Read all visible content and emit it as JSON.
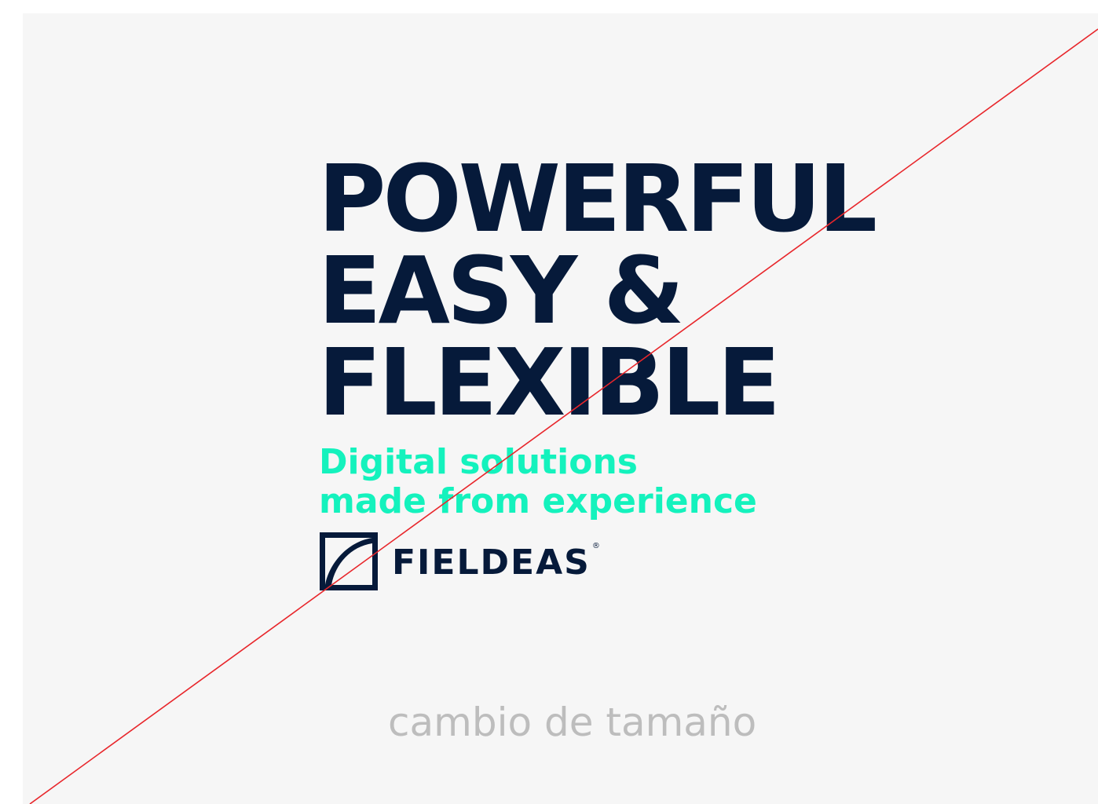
{
  "headline": {
    "line1": "POWERFUL",
    "line2": "EASY &",
    "line3": "FLEXIBLE"
  },
  "tagline": {
    "line1": "Digital solutions",
    "line2": "made from experience"
  },
  "logo": {
    "wordmark": "FIELDEAS",
    "registered": "®"
  },
  "caption": "cambio de tamaño",
  "colors": {
    "navy": "#061a3a",
    "mint": "#14f2bd",
    "caption_gray": "#bdbdbd",
    "strike_red": "#e8262b",
    "background": "#f6f6f6"
  },
  "icons": {
    "logo_mark": "fieldeas-logo-icon"
  }
}
